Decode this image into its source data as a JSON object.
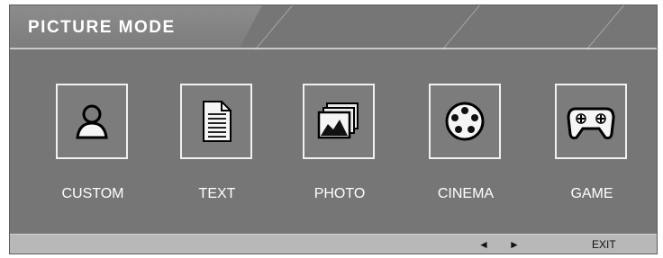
{
  "title": "PICTURE MODE",
  "modes": [
    {
      "label": "CUSTOM",
      "icon": "person-icon"
    },
    {
      "label": "TEXT",
      "icon": "document-icon"
    },
    {
      "label": "PHOTO",
      "icon": "photo-icon"
    },
    {
      "label": "CINEMA",
      "icon": "film-reel-icon"
    },
    {
      "label": "GAME",
      "icon": "gamepad-icon"
    }
  ],
  "footer": {
    "left_arrow": "◄",
    "right_arrow": "►",
    "exit_label": "EXIT"
  },
  "colors": {
    "panel": "#7a7a7a",
    "footer": "#b8b8b8",
    "text": "#ffffff"
  }
}
